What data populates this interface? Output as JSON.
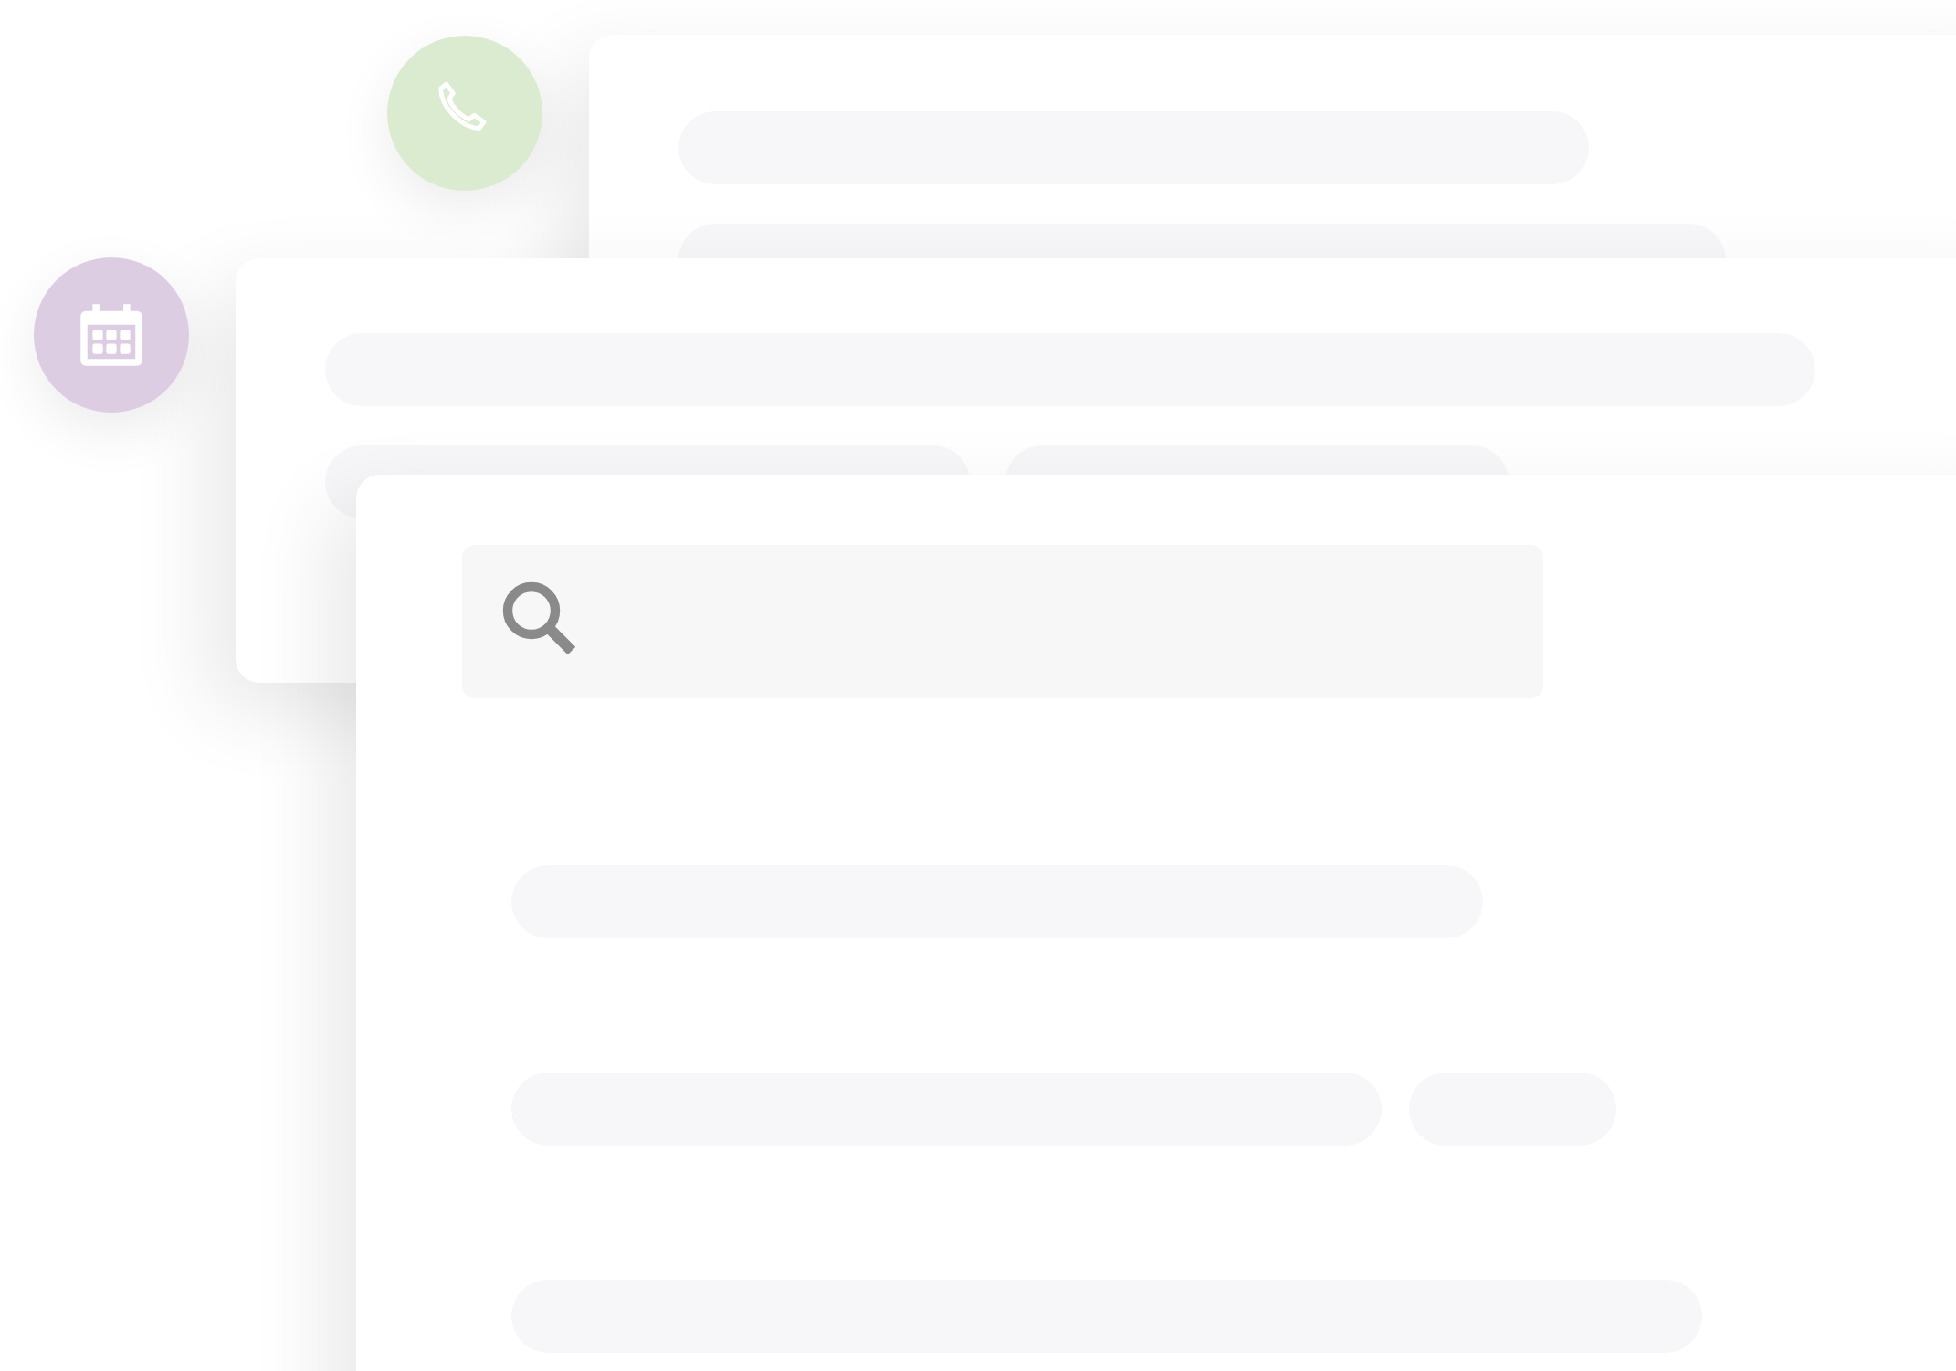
{
  "cards": [
    {
      "kind": "skeleton"
    },
    {
      "kind": "skeleton"
    },
    {
      "kind": "search"
    }
  ],
  "badges": [
    {
      "kind": "phone",
      "color": "#dbebcf"
    },
    {
      "kind": "calendar",
      "color": "#dccde3"
    }
  ]
}
